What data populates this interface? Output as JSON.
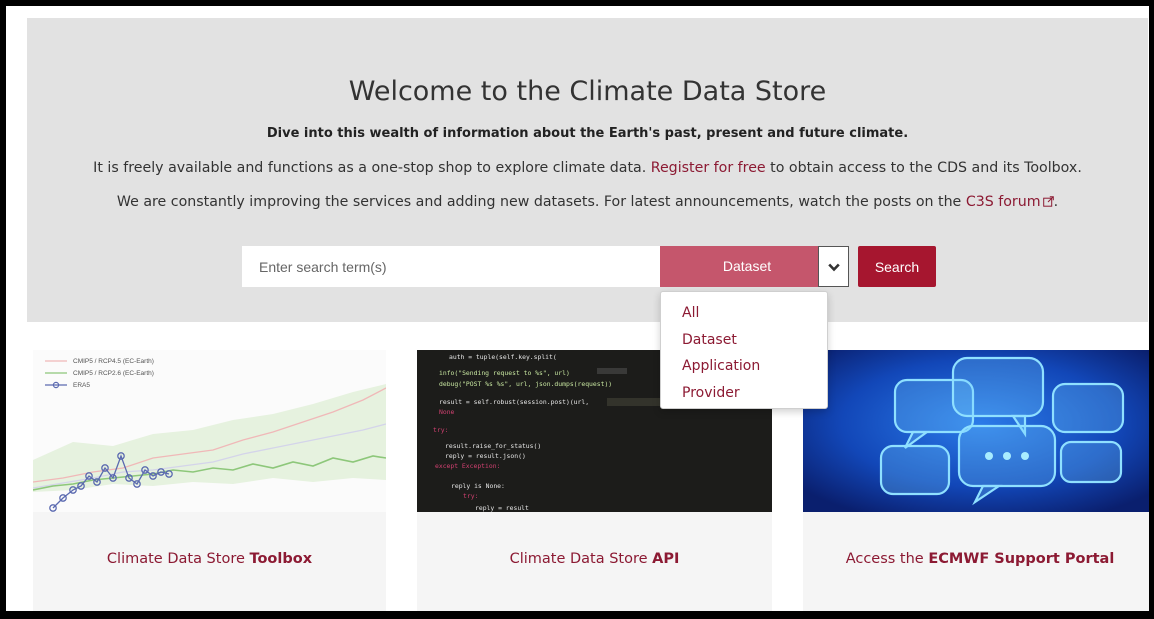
{
  "hero": {
    "title": "Welcome to the Climate Data Store",
    "subtitle": "Dive into this wealth of information about the Earth's past, present and future climate.",
    "line1_pre": "It is freely available and functions as a one-stop shop to explore climate data. ",
    "line1_link": "Register for free",
    "line1_post": " to obtain access to the CDS and its Toolbox.",
    "line2_pre": "We are constantly improving the services and adding new datasets. For latest announcements, watch the posts on the ",
    "line2_link": "C3S forum",
    "line2_post": "."
  },
  "search": {
    "placeholder": "Enter search term(s)",
    "selected": "Dataset",
    "button": "Search",
    "options": [
      "All",
      "Dataset",
      "Application",
      "Provider"
    ]
  },
  "cards": [
    {
      "caption_pre": "Climate Data Store ",
      "caption_bold": "Toolbox",
      "legend": [
        "CMIP5 / RCP4.5 (EC-Earth)",
        "CMIP5 / RCP2.6 (EC-Earth)",
        "ERA5"
      ]
    },
    {
      "caption_pre": "Climate Data Store ",
      "caption_bold": "API",
      "code_lines": [
        "auth = tuple(self.key.split(",
        "info(\"Sending request to %s\", url)",
        "debug(\"POST %s %s\", url, json.dumps(request))",
        "result = self.robust(session.post)(url,",
        "None",
        "try:",
        "result.raise_for_status()",
        "reply = result.json()",
        "except Exception:",
        "reply is None:",
        "try:",
        "reply = result"
      ]
    },
    {
      "caption_pre": "Access the ",
      "caption_bold": "ECMWF Support Portal"
    }
  ],
  "colors": {
    "accent": "#8c1a33",
    "select_bg": "#c5566c",
    "button_bg": "#a6162f",
    "hero_bg": "#e2e2e2"
  },
  "icons": {
    "select_toggle": "chevron-down-icon",
    "external_link": "external-link-icon"
  }
}
